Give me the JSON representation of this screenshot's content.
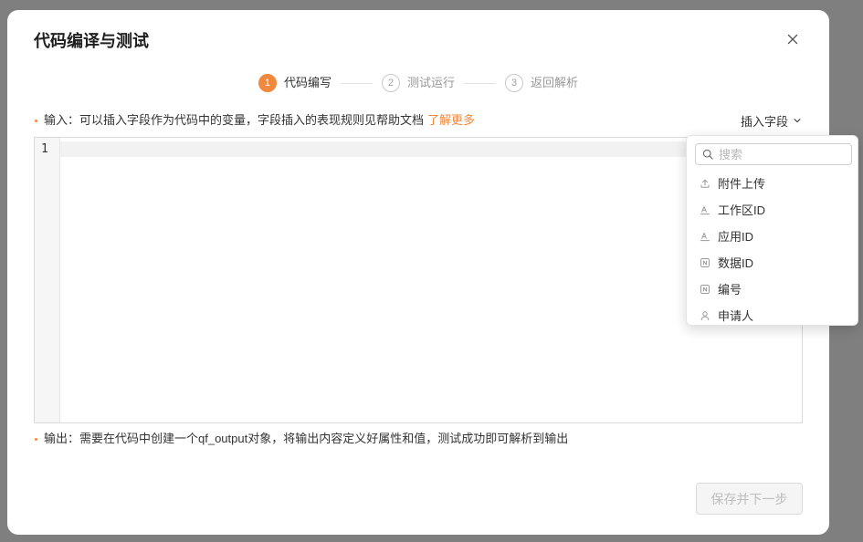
{
  "modal": {
    "title": "代码编译与测试"
  },
  "current_step": 1,
  "steps": [
    {
      "number": "1",
      "label": "代码编写"
    },
    {
      "number": "2",
      "label": "测试运行"
    },
    {
      "number": "3",
      "label": "返回解析"
    }
  ],
  "input_hint": {
    "text": "输入：可以插入字段作为代码中的变量，字段插入的表现规则见帮助文档",
    "link_label": "了解更多"
  },
  "insert_field": {
    "label": "插入字段"
  },
  "editor": {
    "line_numbers": [
      "1"
    ],
    "lines": [
      ""
    ]
  },
  "field_dropdown": {
    "search_placeholder": "搜索",
    "items": [
      {
        "icon": "upload-icon",
        "label": "附件上传"
      },
      {
        "icon": "text-field-icon",
        "label": "工作区ID"
      },
      {
        "icon": "text-field-icon",
        "label": "应用ID"
      },
      {
        "icon": "number-field-icon",
        "label": "数据ID"
      },
      {
        "icon": "number-field-icon",
        "label": "编号"
      },
      {
        "icon": "person-icon",
        "label": "申请人"
      }
    ]
  },
  "output_hint": {
    "text": "输出：需要在代码中创建一个qf_output对象，将输出内容定义好属性和值，测试成功即可解析到输出"
  },
  "footer": {
    "next_label": "保存并下一步",
    "next_enabled": false
  },
  "colors": {
    "accent": "#f0883e",
    "overlay": "#7f7f7f"
  }
}
